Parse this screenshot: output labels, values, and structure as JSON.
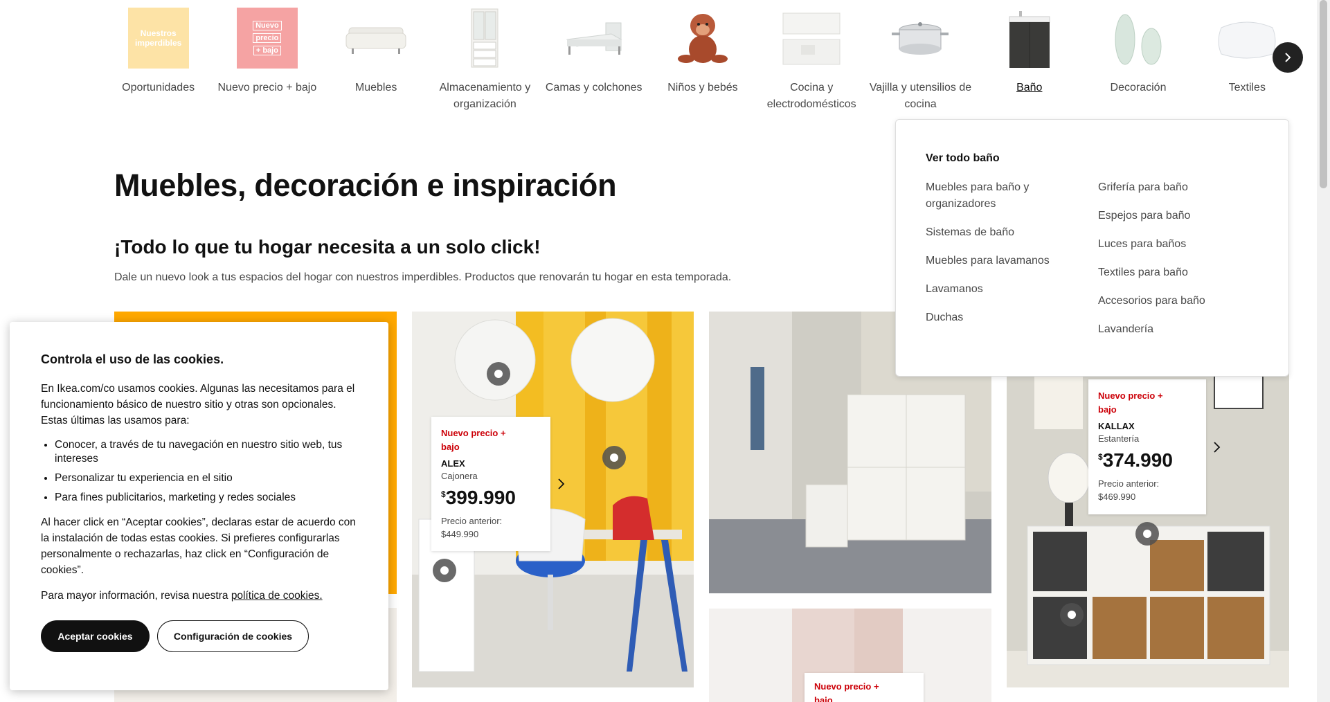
{
  "categories": [
    {
      "label": "Oportunidades",
      "thumb_text": "Nuestros imperdibles"
    },
    {
      "label": "Nuevo precio + bajo",
      "thumb_text": [
        "Nuevo",
        "precio",
        "+ bajo"
      ]
    },
    {
      "label": "Muebles"
    },
    {
      "label": "Almacenamiento y organización"
    },
    {
      "label": "Camas y colchones"
    },
    {
      "label": "Niños y bebés"
    },
    {
      "label": "Cocina y electrodomésticos"
    },
    {
      "label": "Vajilla y utensilios de cocina"
    },
    {
      "label": "Baño",
      "active": true
    },
    {
      "label": "Decoración"
    },
    {
      "label": "Textiles"
    }
  ],
  "hero": {
    "title": "Muebles, decoración e inspiración",
    "subtitle": "¡Todo lo que tu hogar necesita a un solo click!",
    "intro": "Dale un nuevo look a tus espacios del hogar con nuestros imperdibles. Productos que renovarán tu hogar en esta temporada."
  },
  "dropdown": {
    "heading": "Ver todo baño",
    "col1": [
      "Muebles para baño y organizadores",
      "Sistemas de baño",
      "Muebles para lavamanos",
      "Lavamanos",
      "Duchas"
    ],
    "col2": [
      "Grifería para baño",
      "Espejos para baño",
      "Luces para baños",
      "Textiles para baño",
      "Accesorios para baño",
      "Lavandería"
    ]
  },
  "products": {
    "alex": {
      "tag": "Nuevo precio + bajo",
      "name": "ALEX",
      "type": "Cajonera",
      "currency": "$",
      "price": "399.990",
      "old_label": "Precio anterior:",
      "old_price": "$449.990"
    },
    "kallax": {
      "tag": "Nuevo precio + bajo",
      "name": "KALLAX",
      "type": "Estantería",
      "currency": "$",
      "price": "374.990",
      "old_label": "Precio anterior:",
      "old_price": "$469.990"
    },
    "bottom": {
      "tag": "Nuevo precio + bajo"
    }
  },
  "cookie": {
    "title": "Controla el uso de las cookies.",
    "p1": "En Ikea.com/co usamos cookies. Algunas las necesitamos para el funcionamiento básico de nuestro sitio y otras son opcionales. Estas últimas las usamos para:",
    "bullets": [
      "Conocer, a través de tu navegación en nuestro sitio web, tus intereses",
      "Personalizar tu experiencia en el sitio",
      "Para fines publicitarios, marketing y redes sociales"
    ],
    "p2": "Al hacer click en “Aceptar cookies”, declaras estar de acuerdo con la instalación de todas estas cookies. Si prefieres configurarlas personalmente o rechazarlas, haz click en “Configuración de cookies”.",
    "p3_prefix": "Para mayor información, revisa nuestra ",
    "p3_link": "política de cookies.",
    "accept": "Aceptar cookies",
    "config": "Configuración de cookies"
  },
  "colors": {
    "accent_red": "#cc0008",
    "ikea_yellow": "#ffa800",
    "dark": "#111111"
  }
}
